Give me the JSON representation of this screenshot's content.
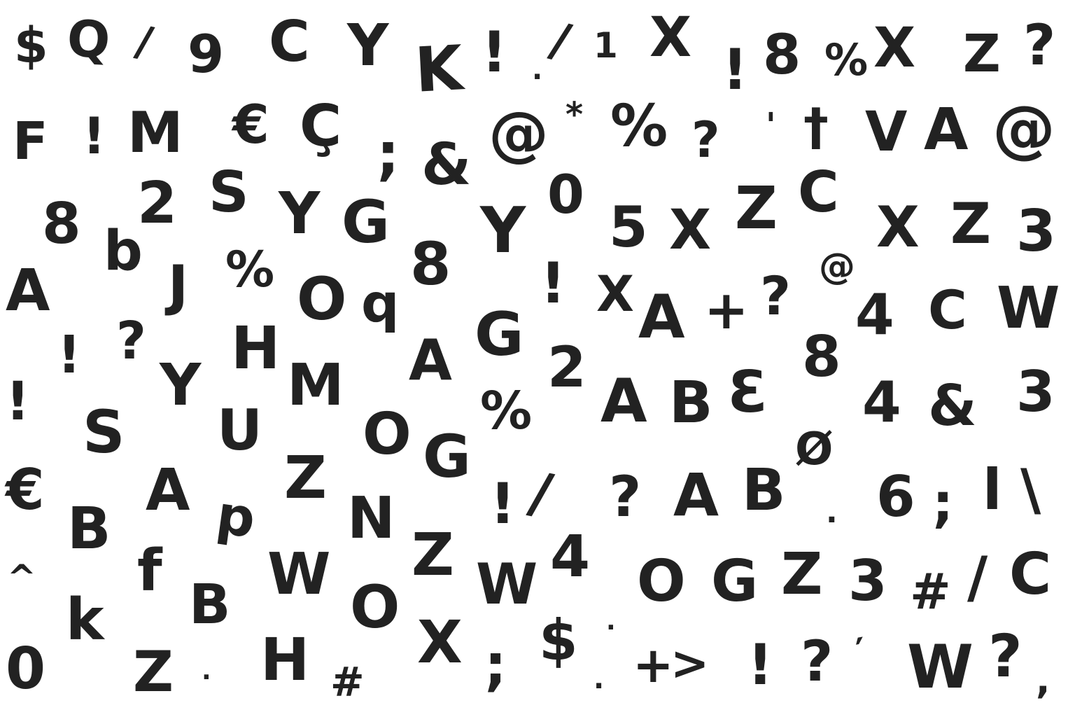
{
  "sheet": {
    "background_color": "#ffffff",
    "ink_color": "#222222",
    "glyphs": [
      "$",
      "Q",
      "/",
      "9",
      "C",
      "Y",
      "K",
      "!",
      ".",
      "/",
      "1",
      "X",
      "!",
      "8",
      "%",
      "X",
      "Z",
      "?",
      "F",
      "!",
      "M",
      "€",
      "Ç",
      ";",
      "&",
      "@",
      "*",
      "%",
      "?",
      "'",
      "†",
      "V",
      "A",
      "@",
      "8",
      "b",
      "2",
      "S",
      "Y",
      "G",
      "8",
      "Y",
      "0",
      "5",
      "X",
      "Z",
      "C",
      "X",
      "Z",
      "3",
      "A",
      "J",
      "%",
      "O",
      "q",
      "!",
      "X",
      "A",
      "+",
      "?",
      "@",
      "4",
      "C",
      "W",
      "!",
      "?",
      "H",
      "A",
      "G",
      "2",
      "8",
      "!",
      "S",
      "Y",
      "U",
      "M",
      "%",
      "A",
      "B",
      "Ɛ",
      "4",
      "&",
      "3",
      "O",
      "G",
      "Ø",
      "€",
      "A",
      "Z",
      "!",
      "/",
      "?",
      "A",
      "B",
      ".",
      "6",
      ";",
      "l",
      "\\",
      "B",
      "p",
      "N",
      "Z",
      "^",
      "f",
      "B",
      "W",
      "W",
      "4",
      "O",
      "G",
      "Z",
      "3",
      "#",
      "/",
      "C",
      "k",
      "O",
      ".",
      "0",
      "Z",
      "·",
      "H",
      "#",
      "X",
      ";",
      "$",
      ".",
      "+",
      ">",
      "!",
      "?",
      "′",
      "W",
      "?",
      ","
    ]
  }
}
